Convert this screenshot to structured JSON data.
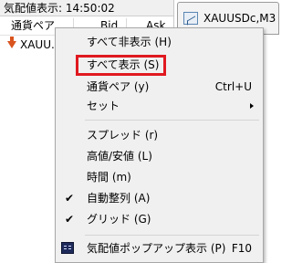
{
  "panel": {
    "title": "気配値表示: 14:50:02",
    "columns": {
      "symbol": "通貨ペア",
      "bid": "Bid",
      "ask": "Ask"
    },
    "rows": [
      {
        "symbol": "XAUU..."
      }
    ]
  },
  "chart_tab": {
    "label": "XAUUSDc,M3"
  },
  "menu": {
    "hide_all": "すべて非表示 (H)",
    "show_all": "すべて表示 (S)",
    "pair": "通貨ペア (y)",
    "pair_shortcut": "Ctrl+U",
    "sets": "セット",
    "spread": "スプレッド (r)",
    "high_low": "高値/安値 (L)",
    "time": "時間 (m)",
    "auto_arrange": "自動整列 (A)",
    "grid": "グリッド (G)",
    "popup": "気配値ポップアップ表示 (P)",
    "popup_shortcut": "F10",
    "check_mark": "✔"
  },
  "colors": {
    "highlight": "#e0191f",
    "down_arrow": "#d9541e"
  }
}
